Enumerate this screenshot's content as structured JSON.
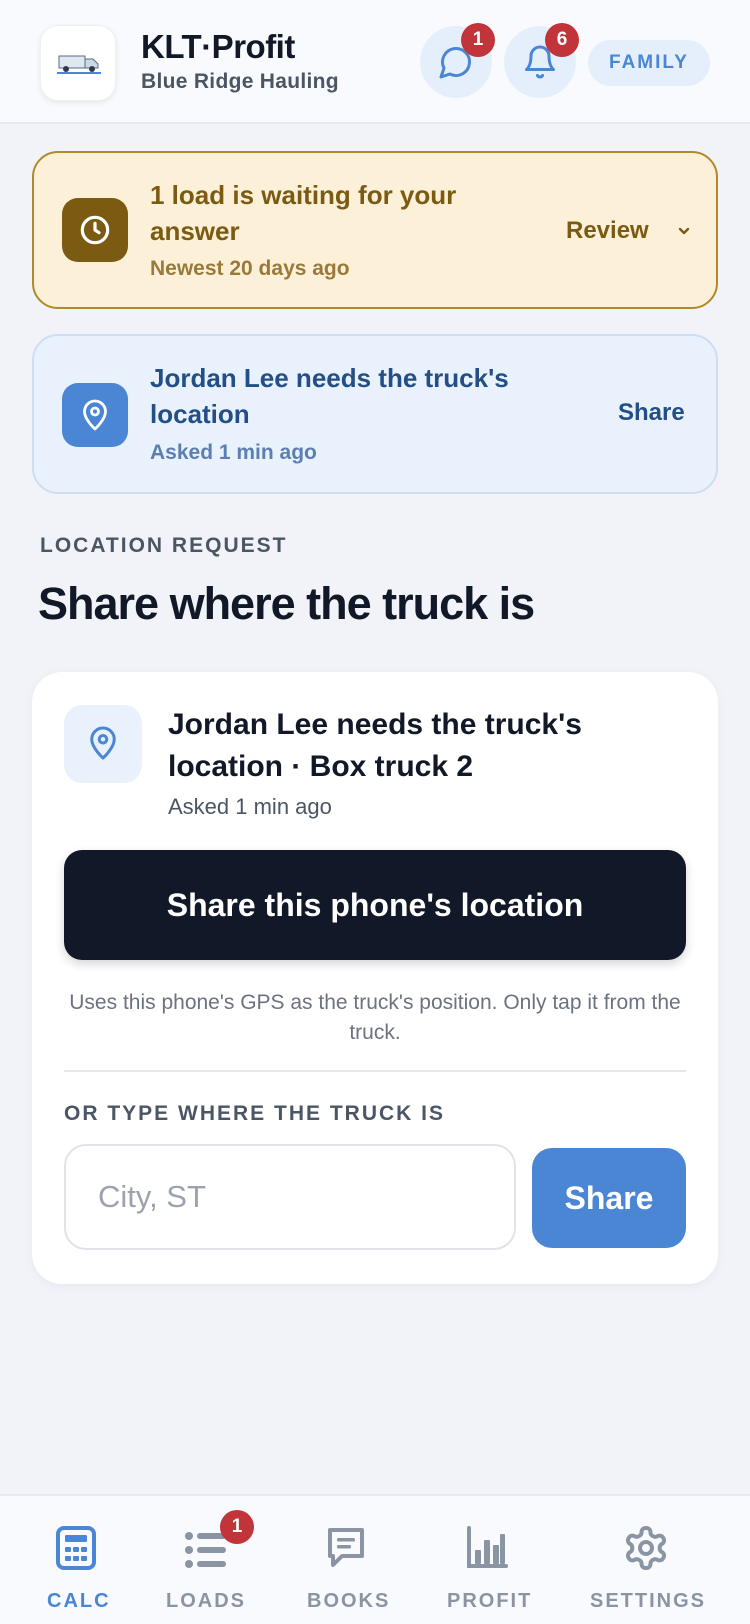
{
  "header": {
    "title": "KLT·Profit",
    "subtitle": "Blue Ridge Hauling",
    "messages_badge": "1",
    "notifications_badge": "6",
    "role_pill": "FAMILY"
  },
  "pending_banner": {
    "title": "1 load is waiting for your answer",
    "time": "Newest 20 days ago",
    "action": "Review"
  },
  "location_banner": {
    "title": "Jordan Lee needs the truck's location",
    "time": "Asked 1 min ago",
    "action": "Share"
  },
  "section": {
    "eyebrow": "LOCATION REQUEST",
    "heading": "Share where the truck is"
  },
  "card": {
    "title": "Jordan Lee needs the truck's location · Box truck 2",
    "time": "Asked 1 min ago",
    "primary_button": "Share this phone's location",
    "help": "Uses this phone's GPS as the truck's position. Only tap it from the truck.",
    "or_label": "OR TYPE WHERE THE TRUCK IS",
    "input_placeholder": "City, ST",
    "input_value": "",
    "share_button": "Share"
  },
  "bottom_nav": {
    "items": [
      {
        "label": "CALC",
        "icon": "calculator-icon",
        "active": true
      },
      {
        "label": "LOADS",
        "icon": "list-icon",
        "badge": "1"
      },
      {
        "label": "BOOKS",
        "icon": "book-icon"
      },
      {
        "label": "PROFIT",
        "icon": "bar-chart-icon"
      },
      {
        "label": "SETTINGS",
        "icon": "gear-icon"
      }
    ]
  },
  "colors": {
    "accent": "#4a86d4",
    "warning_bg": "#fcf1d8",
    "warning_text": "#7b5a12",
    "badge": "#c0343a",
    "primary_button": "#111827"
  }
}
